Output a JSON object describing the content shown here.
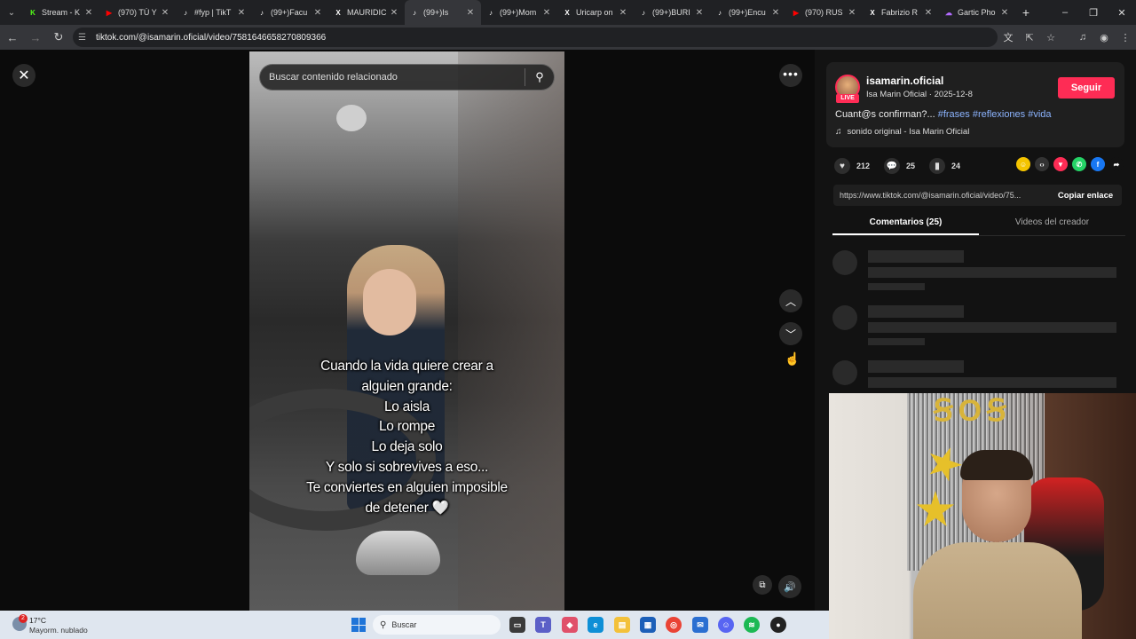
{
  "browser": {
    "tabs": [
      {
        "label": "Stream - K",
        "icon": "kick-icon",
        "color": "#53fc18",
        "active": false
      },
      {
        "label": "(970) TÚ Y",
        "icon": "youtube-icon",
        "color": "#ff0000",
        "active": false
      },
      {
        "label": "#fyp | TikT",
        "icon": "tiktok-icon",
        "color": "#ffffff",
        "active": false
      },
      {
        "label": "(99+)Facu",
        "icon": "tiktok-icon",
        "color": "#ffffff",
        "active": false
      },
      {
        "label": "MAURIDIC",
        "icon": "x-icon",
        "color": "#ffffff",
        "active": false
      },
      {
        "label": "(99+)Is",
        "icon": "tiktok-icon",
        "color": "#ffffff",
        "active": true
      },
      {
        "label": "(99+)Mom",
        "icon": "tiktok-icon",
        "color": "#ffffff",
        "active": false
      },
      {
        "label": "Uricarp on",
        "icon": "x-icon",
        "color": "#ffffff",
        "active": false
      },
      {
        "label": "(99+)BURI",
        "icon": "tiktok-icon",
        "color": "#ffffff",
        "active": false
      },
      {
        "label": "(99+)Encu",
        "icon": "tiktok-icon",
        "color": "#ffffff",
        "active": false
      },
      {
        "label": "(970) RUS",
        "icon": "youtube-icon",
        "color": "#ff0000",
        "active": false
      },
      {
        "label": "Fabrizio R",
        "icon": "x-icon",
        "color": "#ffffff",
        "active": false
      },
      {
        "label": "Gartic Pho",
        "icon": "gartic-icon",
        "color": "#b36bff",
        "active": false
      }
    ],
    "url": "tiktok.com/@isamarin.oficial/video/7581646658270809366"
  },
  "video": {
    "search_placeholder": "Buscar contenido relacionado",
    "caption_lines": [
      "Cuando la vida quiere crear a",
      "alguien grande:",
      "Lo aisla",
      "Lo rompe",
      "Lo deja solo",
      "Y solo si sobrevives a eso...",
      "Te conviertes en alguien imposible",
      "de detener 🤍"
    ]
  },
  "creator": {
    "username": "isamarin.oficial",
    "display_name": "Isa Marin Oficial",
    "date": "2025-12-8",
    "separator": " · ",
    "live_label": "LIVE",
    "follow_label": "Seguir",
    "description_text": "Cuant@s confirman?... ",
    "hashtags": [
      "#frases",
      "#reflexiones",
      "#vida"
    ],
    "music": "sonido original - Isa Marin Oficial"
  },
  "stats": {
    "likes": "212",
    "comments": "25",
    "saves": "24"
  },
  "share_icons": [
    {
      "name": "friends-share-icon",
      "color": "#f5c400",
      "glyph": "☺"
    },
    {
      "name": "embed-icon",
      "color": "#333333",
      "glyph": "‹›"
    },
    {
      "name": "send-icon",
      "color": "#fe2c55",
      "glyph": "▼"
    },
    {
      "name": "whatsapp-icon",
      "color": "#25d366",
      "glyph": "✆"
    },
    {
      "name": "facebook-icon",
      "color": "#1877f2",
      "glyph": "f"
    },
    {
      "name": "share-arrow-icon",
      "color": "#121212",
      "glyph": "➦"
    }
  ],
  "copy_link": {
    "url": "https://www.tiktok.com/@isamarin.oficial/video/75...",
    "button": "Copiar enlace"
  },
  "panel_tabs": [
    {
      "label": "Comentarios (25)",
      "active": true
    },
    {
      "label": "Videos del creador",
      "active": false
    }
  ],
  "taskbar": {
    "temperature": "17°C",
    "weather": "Mayorm. nublado",
    "weather_badge": "2",
    "search_label": "Buscar"
  }
}
